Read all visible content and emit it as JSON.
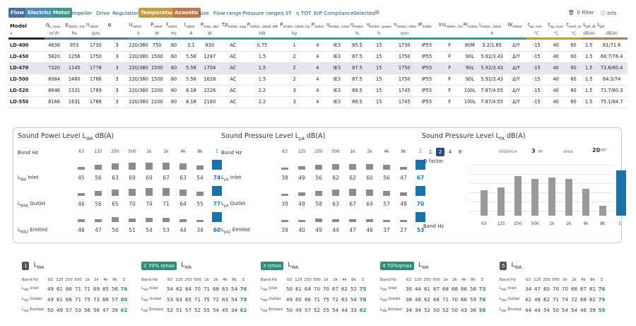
{
  "toolbar": {
    "tags": [
      {
        "label": "Flow",
        "color": "#4a6fa5"
      },
      {
        "label": "Electrical",
        "color": "#4a8fb5"
      },
      {
        "label": "Motor",
        "color": "#3a9a8c"
      }
    ],
    "links1": [
      "Impeller",
      "Drive",
      "Regulation"
    ],
    "tags2": [
      {
        "label": "Temperature",
        "color": "#c49a3c"
      },
      {
        "label": "Acoustic",
        "color": "#c0784a"
      }
    ],
    "links2": [
      "Size",
      "Flow range",
      "Pressure range",
      "η ST",
      "η TOT",
      "ErP Compliance",
      "Selected"
    ],
    "filter": "Filter",
    "info": "Info"
  },
  "table": {
    "units": [
      "x",
      "m³/h",
      "Pa",
      "rpm",
      "",
      "V",
      "W",
      "Hz",
      "A",
      "W",
      "",
      "kW",
      "hp",
      "",
      "",
      "%",
      "%",
      "rpm",
      "",
      "",
      "",
      "A",
      "",
      "°C",
      "°C",
      "°C",
      "dB(A)",
      "dB(A)"
    ],
    "rows": [
      [
        "LD-400",
        "4638",
        "953",
        "1730",
        "3",
        "220/380",
        "750",
        "60",
        "3.1",
        "830",
        "AC",
        "0.75",
        "1",
        "4",
        "IE3",
        "85.5",
        "15",
        "1730",
        "IP55",
        "F",
        "80M",
        "3.2/1.85",
        "Δ/Y",
        "-15",
        "40",
        "60",
        "1.5",
        "61/71.6"
      ],
      [
        "LD-450",
        "5820",
        "1256",
        "1750",
        "3",
        "220/380",
        "1500",
        "60",
        "5.58",
        "1247",
        "AC",
        "1.5",
        "2",
        "4",
        "IE3",
        "87.5",
        "15",
        "1750",
        "IP55",
        "F",
        "90L",
        "5.92/3.43",
        "Δ/Y",
        "-15",
        "40",
        "60",
        "1.5",
        "68.7/76.4"
      ],
      [
        "LD-470",
        "7320",
        "1145",
        "1778",
        "3",
        "220/380",
        "1500",
        "60",
        "5.58",
        "1704",
        "AC",
        "1.5",
        "2",
        "4",
        "IE3",
        "87.5",
        "15",
        "1750",
        "IP55",
        "F",
        "90L",
        "5.92/3.43",
        "Δ/Y",
        "-15",
        "40",
        "60",
        "1.5",
        "73.6/80.4"
      ],
      [
        "LD-500",
        "6084",
        "1480",
        "1786",
        "3",
        "220/380",
        "1500",
        "60",
        "5.58",
        "1628",
        "AC",
        "1.5",
        "2",
        "4",
        "IE3",
        "87.5",
        "15",
        "1750",
        "IP55",
        "F",
        "90L",
        "5.92/3.43",
        "Δ/Y",
        "-15",
        "40",
        "60",
        "1.5",
        "64.3/74"
      ],
      [
        "LD-520",
        "8646",
        "1531",
        "1789",
        "3",
        "220/380",
        "2200",
        "60",
        "8.18",
        "2226",
        "AC",
        "2.2",
        "3",
        "4",
        "IE3",
        "89.5",
        "15",
        "1745",
        "IP55",
        "F",
        "100L",
        "7.87/4.55",
        "Δ/Y",
        "-15",
        "40",
        "60",
        "1.5",
        "71.7/80.3"
      ],
      [
        "LD-550",
        "8166",
        "1631",
        "1788",
        "3",
        "220/380",
        "2200",
        "60",
        "8.18",
        "2160",
        "AC",
        "2.2",
        "3",
        "4",
        "IE3",
        "89.5",
        "15",
        "1745",
        "IP55",
        "F",
        "100L",
        "7.87/4.55",
        "Δ/Y",
        "-15",
        "40",
        "60",
        "1.5",
        "75.1/84.7"
      ]
    ]
  },
  "sound_power": {
    "title": "Sound Powel Level",
    "sym": "L",
    "sub": "WA",
    "unit": " dB(A)",
    "band_label": "Band Hz",
    "bands": [
      "63",
      "125",
      "250",
      "500",
      "1k",
      "2k",
      "4k",
      "8k",
      "Σ"
    ],
    "rows": [
      {
        "label": "Inlet",
        "sym": "L",
        "sub": "WA",
        "values": [
          45,
          56,
          63,
          69,
          69,
          67,
          63,
          54
        ],
        "total": 74
      },
      {
        "label": "Outlet",
        "sym": "L",
        "sub": "WA6",
        "values": [
          46,
          56,
          65,
          70,
          74,
          71,
          64,
          55
        ],
        "total": 77
      },
      {
        "label": "Emited",
        "sym": "L",
        "sub": "WA2",
        "values": [
          46,
          47,
          56,
          51,
          54,
          53,
          44,
          34
        ],
        "total": 60
      }
    ]
  },
  "sound_pressure": {
    "title": "Sound Pressure Level",
    "sym": "L",
    "sub": "pA",
    "unit": " dB(A)",
    "band_label": "Band Hz",
    "bands": [
      "63",
      "125",
      "250",
      "500",
      "1k",
      "2k",
      "4k",
      "8k",
      "Σ"
    ],
    "rows": [
      {
        "label": "Inlet",
        "sym": "L",
        "sub": "pA",
        "values": [
          38,
          49,
          56,
          62,
          62,
          60,
          56,
          47
        ],
        "total": 67
      },
      {
        "label": "Outlet",
        "sym": "L",
        "sub": "pA",
        "values": [
          39,
          49,
          58,
          63,
          67,
          64,
          57,
          48
        ],
        "total": 70
      },
      {
        "label": "Emited",
        "sym": "L",
        "sub": "pA2",
        "values": [
          39,
          40,
          49,
          44,
          47,
          46,
          37,
          27
        ],
        "total": 53
      }
    ]
  },
  "sound_pressure2": {
    "title": "Sound Pressure Level",
    "sym": "L",
    "sub": "FA",
    "unit": " dB(A)",
    "q_options": [
      "1",
      "2",
      "4",
      "8"
    ],
    "q_selected": "2",
    "q_label": "Q factor",
    "distance_label": "distance",
    "distance_value": "3",
    "distance_unit": "m",
    "area_label": "area",
    "area_value": "20",
    "area_unit": "m²",
    "band_label": "Band Hz",
    "chart_data": {
      "type": "bar",
      "categories": [
        "63",
        "125",
        "250",
        "500",
        "1k",
        "2k",
        "4k",
        "8k",
        "Σ"
      ],
      "values": [
        38,
        40,
        48,
        46,
        47,
        46,
        39,
        27,
        52
      ]
    }
  },
  "cards": [
    {
      "badge": "1",
      "badge_style": "dark",
      "sym": "L",
      "sub": "WA",
      "bands": [
        "Band Hz",
        "63",
        "125",
        "250",
        "500",
        "1k",
        "2k",
        "4k",
        "8k",
        "Σ"
      ],
      "rows": [
        [
          "Inlet",
          "49",
          "61",
          "66",
          "71",
          "71",
          "69",
          "65",
          "56",
          "76"
        ],
        [
          "Outlet",
          "49",
          "61",
          "66",
          "71",
          "75",
          "73",
          "66",
          "57",
          "80"
        ],
        [
          "Emited",
          "50",
          "49",
          "57",
          "53",
          "56",
          "56",
          "47",
          "39",
          "62"
        ]
      ]
    },
    {
      "badge": "2 70% ηmax",
      "badge_style": "green",
      "sym": "L",
      "sub": "WA",
      "bands": [
        "Band Hz",
        "63",
        "125",
        "250",
        "500",
        "1k",
        "2k",
        "4k",
        "8k",
        "Σ"
      ],
      "rows": [
        [
          "Inlet",
          "54",
          "62",
          "64",
          "70",
          "71",
          "68",
          "63",
          "54",
          "76"
        ],
        [
          "Outlet",
          "53",
          "63",
          "65",
          "71",
          "75",
          "72",
          "63",
          "54",
          "78"
        ],
        [
          "Emited",
          "52",
          "51",
          "57",
          "52",
          "55",
          "54",
          "45",
          "34",
          "62"
        ]
      ]
    },
    {
      "badge": "3 ηmax",
      "badge_style": "green",
      "sym": "L",
      "sub": "WA",
      "bands": [
        "Band Hz",
        "63",
        "125",
        "250",
        "500",
        "1k",
        "2k",
        "4k",
        "8k",
        "Σ"
      ],
      "rows": [
        [
          "Inlet",
          "50",
          "61",
          "64",
          "70",
          "70",
          "67",
          "62",
          "52",
          "75"
        ],
        [
          "Outlet",
          "49",
          "60",
          "66",
          "71",
          "75",
          "72",
          "63",
          "54",
          "78"
        ],
        [
          "Emited",
          "50",
          "49",
          "57",
          "52",
          "55",
          "54",
          "44",
          "33",
          "62"
        ]
      ]
    },
    {
      "badge": "4 70%ηmax",
      "badge_style": "green",
      "sym": "L",
      "sub": "WA",
      "bands": [
        "Band Hz",
        "63",
        "125",
        "250",
        "500",
        "1k",
        "2k",
        "4k",
        "8k",
        "Σ"
      ],
      "rows": [
        [
          "Inlet",
          "30",
          "44",
          "61",
          "67",
          "68",
          "66",
          "66",
          "58",
          "73"
        ],
        [
          "Outlet",
          "38",
          "46",
          "62",
          "68",
          "71",
          "70",
          "66",
          "59",
          "76"
        ],
        [
          "Emited",
          "34",
          "34",
          "52",
          "50",
          "52",
          "50",
          "43",
          "36",
          "58"
        ]
      ]
    },
    {
      "badge": "5",
      "badge_style": "dark",
      "sym": "L",
      "sub": "WA",
      "bands": [
        "Band Hz",
        "63",
        "125",
        "250",
        "500",
        "1k",
        "2k",
        "4k",
        "8k",
        "Σ"
      ],
      "rows": [
        [
          "Inlet",
          "34",
          "47",
          "60",
          "70",
          "70",
          "68",
          "67",
          "61",
          "76"
        ],
        [
          "Outlet",
          "42",
          "48",
          "62",
          "71",
          "74",
          "72",
          "68",
          "62",
          "79"
        ],
        [
          "Emited",
          "44",
          "44",
          "54",
          "50",
          "54",
          "54",
          "46",
          "39",
          "59"
        ]
      ]
    }
  ]
}
